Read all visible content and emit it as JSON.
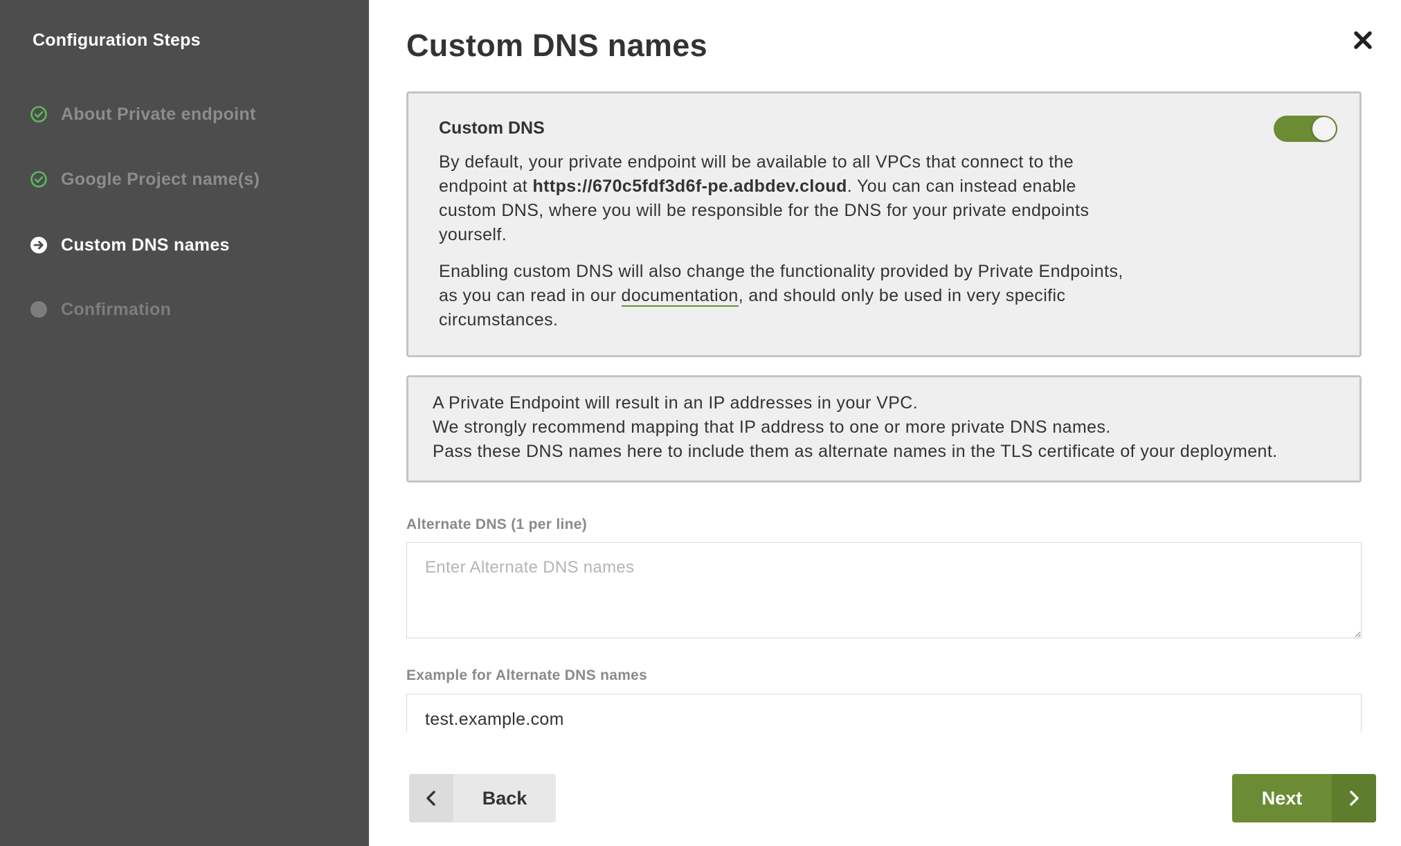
{
  "sidebar": {
    "title": "Configuration Steps",
    "steps": [
      {
        "label": "About Private endpoint",
        "state": "done",
        "icon": "check-circle-icon"
      },
      {
        "label": "Google Project name(s)",
        "state": "done",
        "icon": "check-circle-icon"
      },
      {
        "label": "Custom DNS names",
        "state": "active",
        "icon": "arrow-right-circle-icon"
      },
      {
        "label": "Confirmation",
        "state": "pending",
        "icon": "dot-circle-icon"
      }
    ]
  },
  "header": {
    "title": "Custom DNS names",
    "close_icon": "close-icon"
  },
  "dns_card": {
    "heading": "Custom DNS",
    "toggle_on": true,
    "p1_before": "By default, your private endpoint will be available to all VPCs that connect to the endpoint at ",
    "endpoint_url": "https://670c5fdf3d6f-pe.adbdev.cloud",
    "p1_after": ". You can can instead enable custom DNS, where you will be responsible for the DNS for your private endpoints yourself.",
    "p2_before": "Enabling custom DNS will also change the functionality provided by Private Endpoints, as you can read in our ",
    "p2_link": "documentation",
    "p2_after": ", and should only be used in very specific circumstances."
  },
  "info_card": {
    "line1": "A Private Endpoint will result in an IP addresses in your VPC.",
    "line2": "We strongly recommend mapping that IP address to one or more private DNS names.",
    "line3": "Pass these DNS names here to include them as alternate names in the TLS certificate of your deployment."
  },
  "alternate_dns": {
    "label": "Alternate DNS (1 per line)",
    "placeholder": "Enter Alternate DNS names",
    "value": ""
  },
  "example": {
    "label": "Example for Alternate DNS names",
    "value": "test.example.com"
  },
  "footer": {
    "back_label": "Back",
    "next_label": "Next"
  },
  "colors": {
    "accent": "#6b8c35",
    "sidebar_bg": "#4d4d4d",
    "done_icon": "#5cb85c"
  }
}
